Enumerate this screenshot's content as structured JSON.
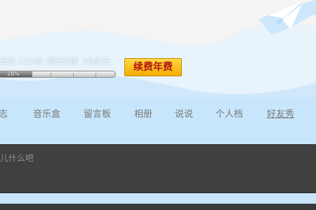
{
  "growth": {
    "value_text": "长值 12148",
    "speed_text": "成长速度",
    "rate_text": "10点/天"
  },
  "progress": {
    "percent": 28,
    "label": "28%"
  },
  "renew_button": {
    "label": "续费年费"
  },
  "nav": {
    "items": [
      {
        "label": "志"
      },
      {
        "label": "音乐盒"
      },
      {
        "label": "留言板"
      },
      {
        "label": "相册"
      },
      {
        "label": "说说"
      },
      {
        "label": "个人档"
      },
      {
        "label": "好友秀"
      }
    ]
  },
  "status": {
    "placeholder": "儿什么吧"
  },
  "colors": {
    "page_background": "#c7e6fb",
    "button_gradient_top": "#ffd84a",
    "button_text": "#b3190f",
    "status_box": "#404040"
  },
  "icons": {
    "decoration": "paper-plane-icon"
  }
}
